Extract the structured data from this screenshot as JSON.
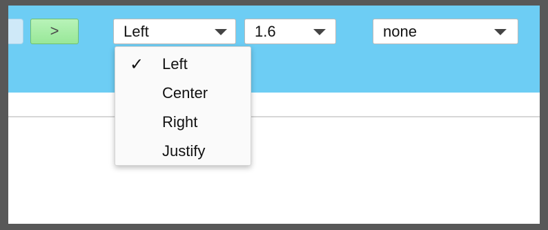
{
  "toolbar": {
    "next_label": ">",
    "alignment": {
      "selected": "Left"
    },
    "line_spacing": {
      "selected": "1.6"
    },
    "extra": {
      "selected": "none"
    }
  },
  "menu": {
    "check_glyph": "✓",
    "items": [
      {
        "label": "Left",
        "checked": true
      },
      {
        "label": "Center",
        "checked": false
      },
      {
        "label": "Right",
        "checked": false
      },
      {
        "label": "Justify",
        "checked": false
      }
    ]
  },
  "colors": {
    "toolbar_bg": "#6dcdf4",
    "next_button": "#a8ecaa",
    "frame": "#585858"
  }
}
